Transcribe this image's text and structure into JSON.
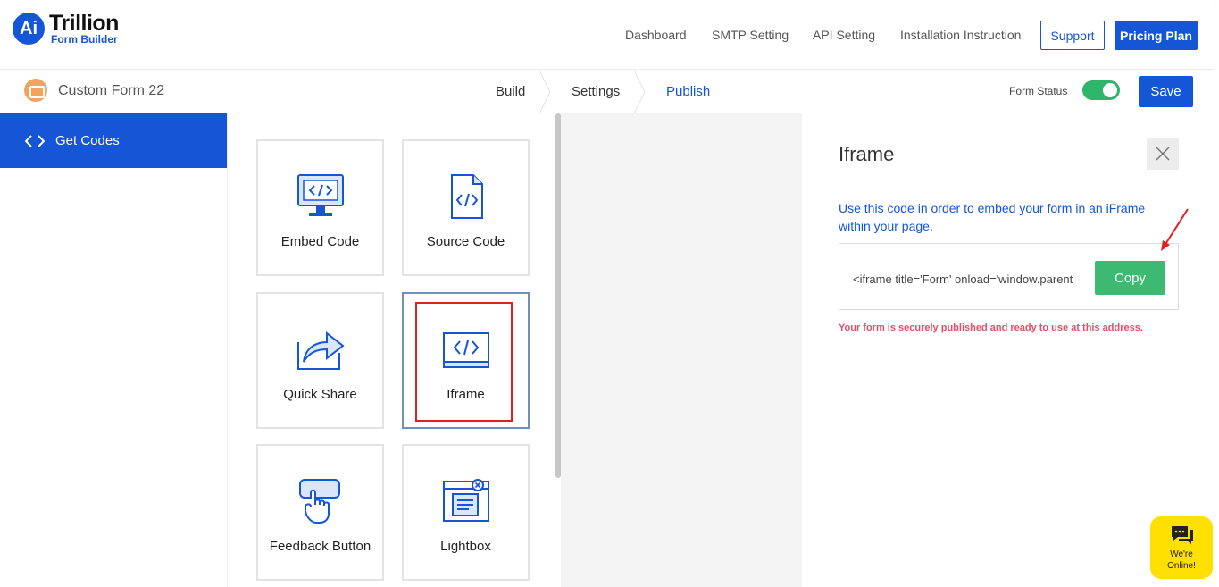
{
  "header": {
    "logo_mark": "Ai",
    "logo_name": "Trillion",
    "logo_sub": "Form Builder",
    "nav": [
      "Dashboard",
      "SMTP Setting",
      "API Setting",
      "Installation Instruction"
    ],
    "support_label": "Support",
    "pricing_label": "Pricing Plan"
  },
  "subbar": {
    "form_name": "Custom Form 22",
    "steps": [
      "Build",
      "Settings",
      "Publish"
    ],
    "active_step": "Publish",
    "status_label": "Form Status",
    "status_on": true,
    "save_label": "Save"
  },
  "sidebar": {
    "items": [
      {
        "label": "Get Codes",
        "icon": "code-icon"
      }
    ]
  },
  "cards": [
    {
      "label": "Embed Code",
      "icon": "monitor-code-icon"
    },
    {
      "label": "Source Code",
      "icon": "file-code-icon"
    },
    {
      "label": "Quick Share",
      "icon": "share-icon"
    },
    {
      "label": "Iframe",
      "icon": "iframe-code-icon"
    },
    {
      "label": "Feedback Button",
      "icon": "feedback-button-icon"
    },
    {
      "label": "Lightbox",
      "icon": "lightbox-icon"
    }
  ],
  "panel": {
    "title": "Iframe",
    "description": "Use this code in order to embed your form in an iFrame within your page.",
    "code": "<iframe title='Form' onload='window.parent",
    "copy_label": "Copy",
    "note": "Your form is securely published and ready to use at this address."
  },
  "chat": {
    "line1": "We're",
    "line2": "Online!"
  },
  "colors": {
    "primary": "#1456d6",
    "success": "#3dba72",
    "danger": "#e0506a",
    "highlight": "#e51f1f",
    "chat": "#ffe000"
  }
}
